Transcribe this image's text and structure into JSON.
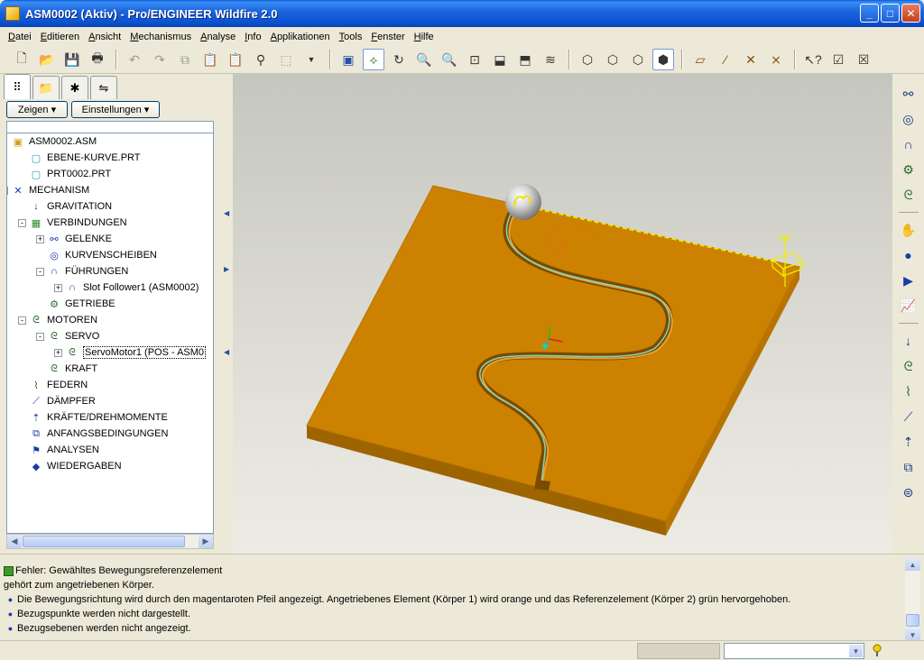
{
  "window": {
    "title": "ASM0002 (Aktiv) - Pro/ENGINEER Wildfire 2.0"
  },
  "menu": [
    "Datei",
    "Editieren",
    "Ansicht",
    "Mechanismus",
    "Analyse",
    "Info",
    "Applikationen",
    "Tools",
    "Fenster",
    "Hilfe"
  ],
  "panel": {
    "show_button": "Zeigen",
    "settings_button": "Einstellungen"
  },
  "tree": [
    {
      "label": "ASM0002.ASM",
      "indent": 0,
      "icon": "assembly-icon",
      "exp": ""
    },
    {
      "label": "EBENE-KURVE.PRT",
      "indent": 1,
      "icon": "part-icon",
      "exp": ""
    },
    {
      "label": "PRT0002.PRT",
      "indent": 1,
      "icon": "part-icon",
      "exp": ""
    },
    {
      "label": "MECHANISM",
      "indent": 0,
      "icon": "mechanism-icon",
      "exp": "-"
    },
    {
      "label": "GRAVITATION",
      "indent": 1,
      "icon": "gravity-icon",
      "exp": ""
    },
    {
      "label": "VERBINDUNGEN",
      "indent": 1,
      "icon": "connections-icon",
      "exp": "-"
    },
    {
      "label": "GELENKE",
      "indent": 2,
      "icon": "joint-icon",
      "exp": "+"
    },
    {
      "label": "KURVENSCHEIBEN",
      "indent": 2,
      "icon": "cam-icon",
      "exp": ""
    },
    {
      "label": "FÜHRUNGEN",
      "indent": 2,
      "icon": "slot-icon",
      "exp": "-"
    },
    {
      "label": "Slot Follower1 (ASM0002)",
      "indent": 3,
      "icon": "slot-icon",
      "exp": "+"
    },
    {
      "label": "GETRIEBE",
      "indent": 2,
      "icon": "gear-icon",
      "exp": ""
    },
    {
      "label": "MOTOREN",
      "indent": 1,
      "icon": "motor-icon",
      "exp": "-"
    },
    {
      "label": "SERVO",
      "indent": 2,
      "icon": "servo-icon",
      "exp": "-"
    },
    {
      "label": "ServoMotor1 (POS - ASM0",
      "indent": 3,
      "icon": "servo-icon",
      "exp": "+",
      "selected": true
    },
    {
      "label": "KRAFT",
      "indent": 2,
      "icon": "force-motor-icon",
      "exp": ""
    },
    {
      "label": "FEDERN",
      "indent": 1,
      "icon": "spring-icon",
      "exp": ""
    },
    {
      "label": "DÄMPFER",
      "indent": 1,
      "icon": "damper-icon",
      "exp": ""
    },
    {
      "label": "KRÄFTE/DREHMOMENTE",
      "indent": 1,
      "icon": "torque-icon",
      "exp": ""
    },
    {
      "label": "ANFANGSBEDINGUNGEN",
      "indent": 1,
      "icon": "initial-conditions-icon",
      "exp": ""
    },
    {
      "label": "ANALYSEN",
      "indent": 1,
      "icon": "analysis-icon",
      "exp": ""
    },
    {
      "label": "WIEDERGABEN",
      "indent": 1,
      "icon": "playback-icon",
      "exp": ""
    }
  ],
  "messages": [
    {
      "type": "error",
      "text": "Fehler: Gewähltes Bewegungsreferenzelement"
    },
    {
      "type": "plain",
      "text": "gehört zum angetriebenen Körper."
    },
    {
      "type": "bullet",
      "text": "Die Bewegungsrichtung wird durch den magentaroten Pfeil angezeigt. Angetriebenes Element (Körper 1) wird orange und das Referenzelement (Körper 2) grün hervorgehoben."
    },
    {
      "type": "bullet",
      "text": "Bezugspunkte werden nicht dargestellt."
    },
    {
      "type": "bullet",
      "text": "Bezugsebenen werden nicht angezeigt."
    }
  ],
  "colors": {
    "plate": "#CC8200",
    "plate_side": "#A86A00",
    "slot_curve": "#7FD8C0",
    "highlight_yellow": "#F0F000",
    "orange_sketch": "#E86A20"
  }
}
